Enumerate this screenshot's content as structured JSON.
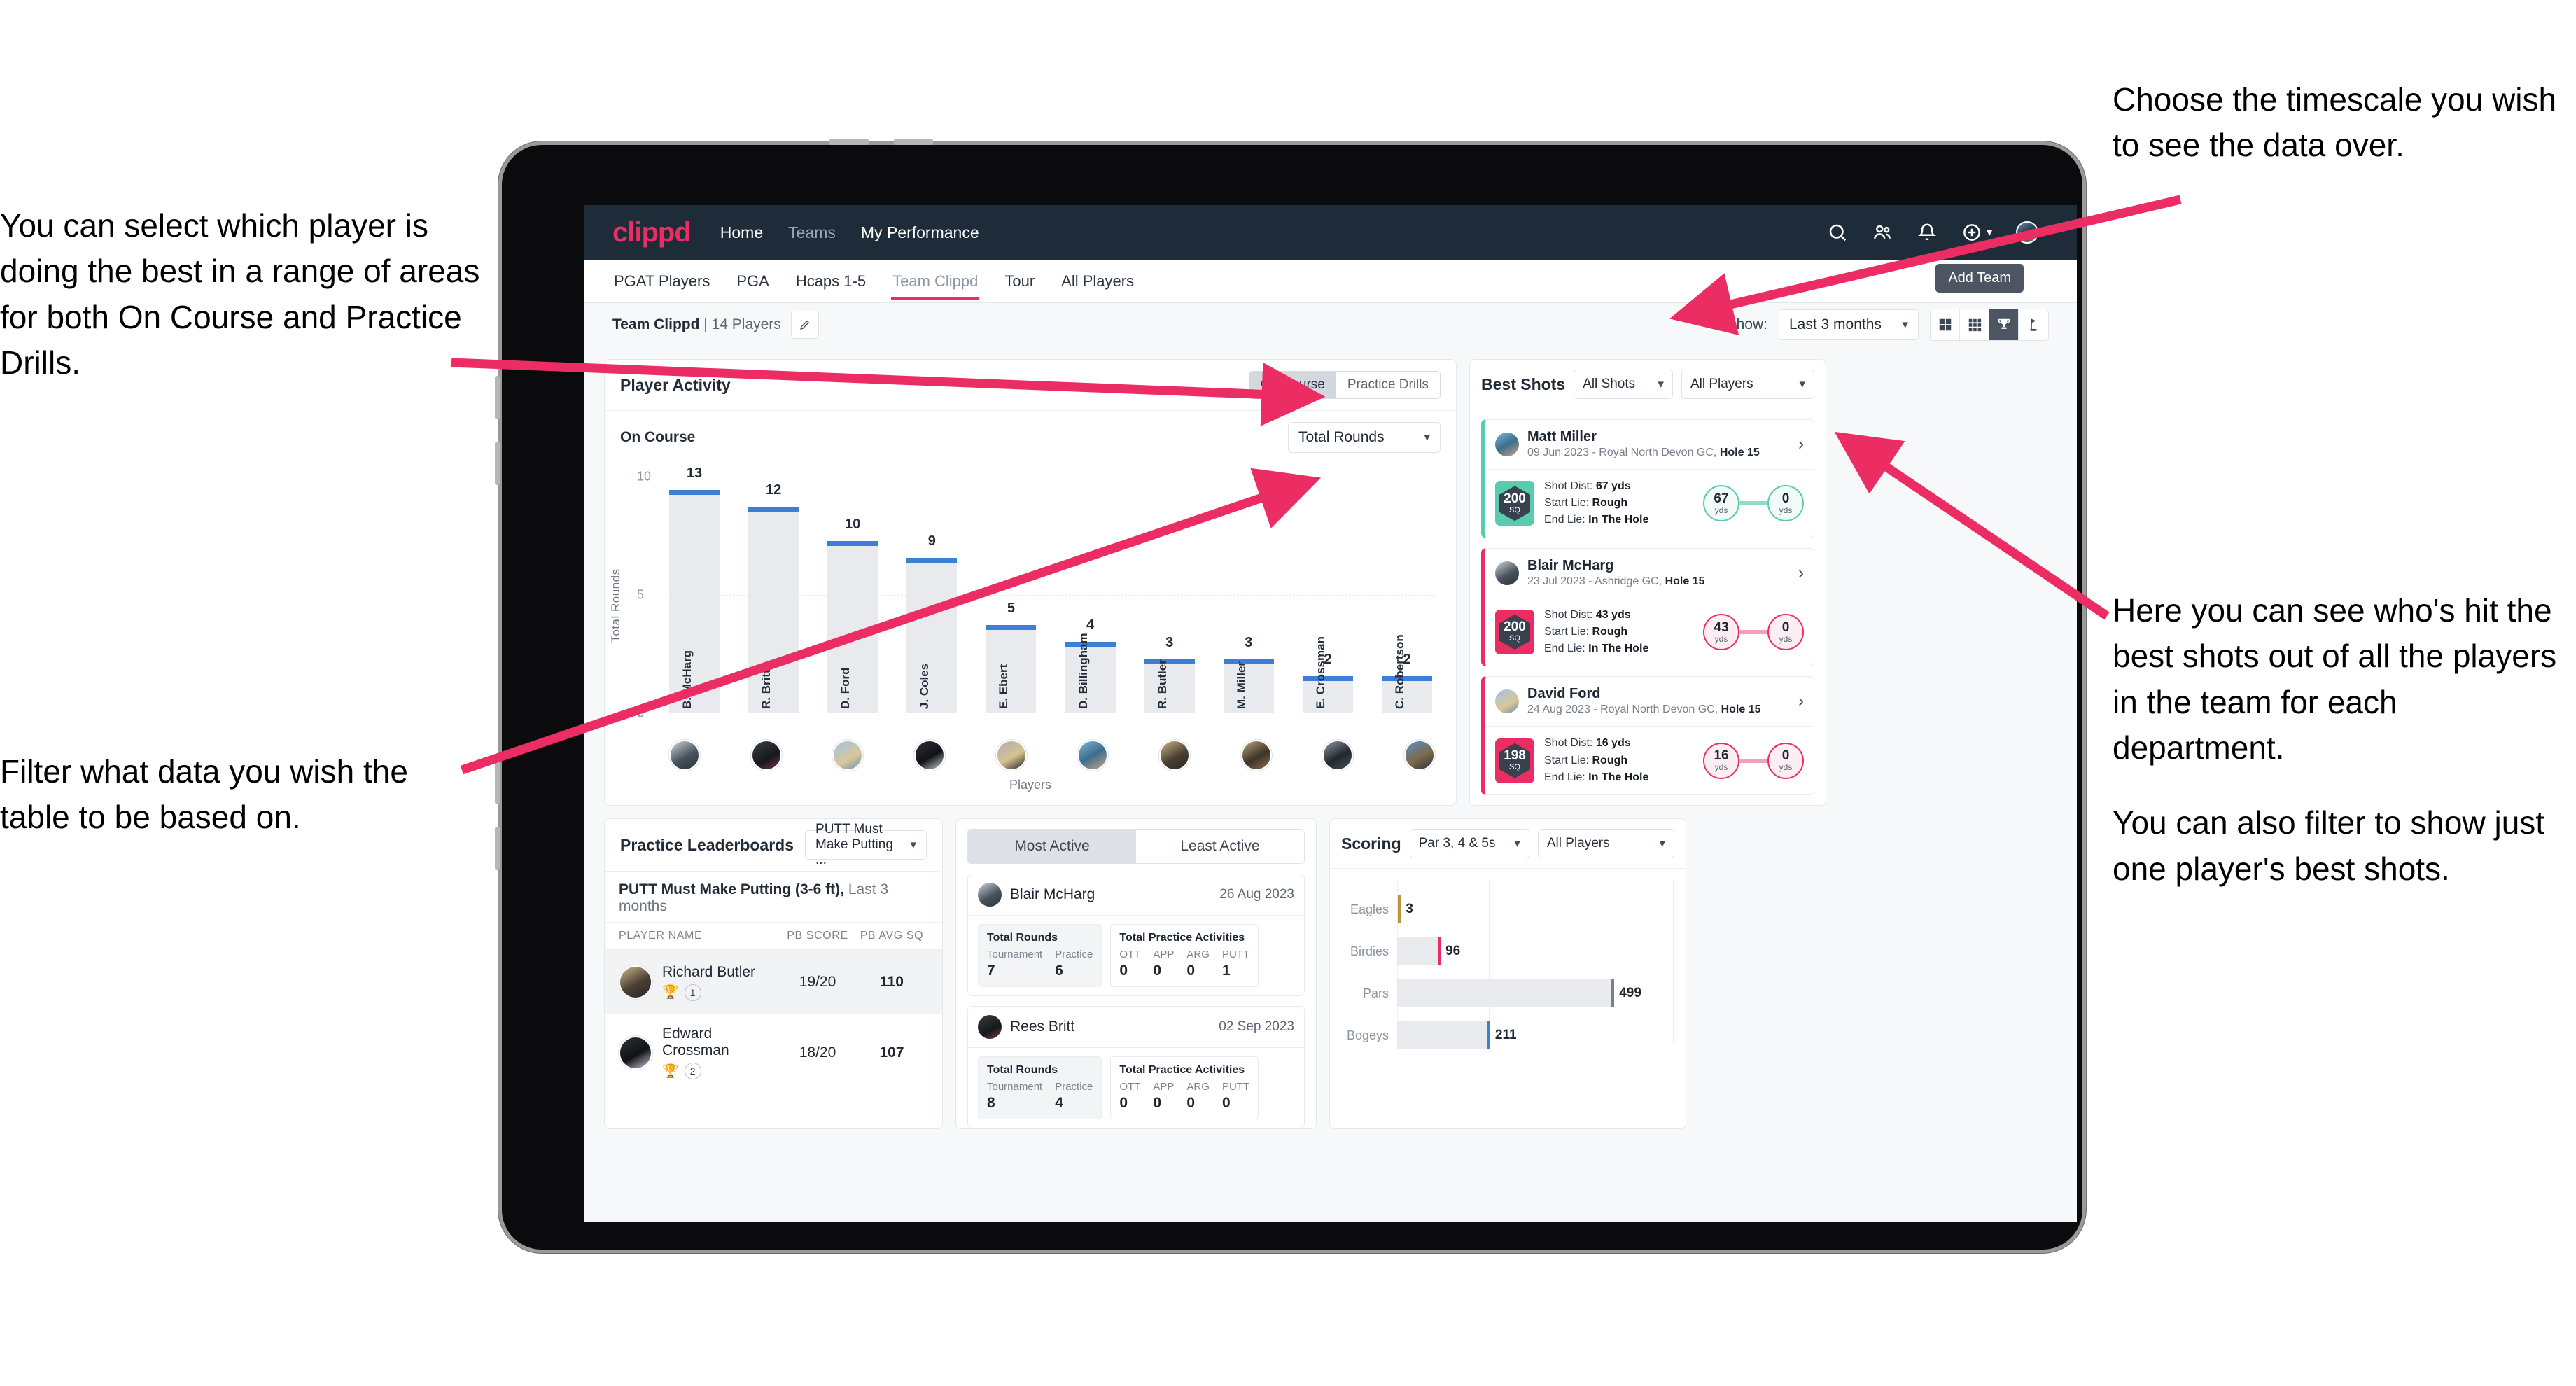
{
  "annotations": {
    "left_top": "You can select which player is doing the best in a range of areas for both On Course and Practice Drills.",
    "left_bottom": "Filter what data you wish the table to be based on.",
    "right_top": "Choose the timescale you wish to see the data over.",
    "right_mid_p1": "Here you can see who's hit the best shots out of all the players in the team for each department.",
    "right_mid_p2": "You can also filter to show just one player's best shots."
  },
  "navbar": {
    "logo": "clippd",
    "links": [
      {
        "label": "Home",
        "dim": false
      },
      {
        "label": "Teams",
        "dim": true
      },
      {
        "label": "My Performance",
        "dim": false
      }
    ],
    "icons": [
      "search-icon",
      "people-icon",
      "bell-icon",
      "plus-circle-icon",
      "avatar"
    ]
  },
  "tabs": {
    "items": [
      {
        "label": "PGAT Players",
        "active": false
      },
      {
        "label": "PGA",
        "active": false
      },
      {
        "label": "Hcaps 1-5",
        "active": false
      },
      {
        "label": "Team Clippd",
        "active": true
      },
      {
        "label": "Tour",
        "active": false
      },
      {
        "label": "All Players",
        "active": false
      }
    ],
    "tooltip": "Add Team"
  },
  "subheader": {
    "team_name": "Team Clippd",
    "team_count": "| 14 Players",
    "show_label": "Show:",
    "timescale": "Last 3 months",
    "view_toggles": [
      {
        "name": "grid-2x2-icon",
        "active": false
      },
      {
        "name": "grid-3x3-icon",
        "active": false
      },
      {
        "name": "trophy-icon",
        "active": true
      },
      {
        "name": "golf-flag-icon",
        "active": false
      }
    ]
  },
  "player_activity": {
    "title": "Player Activity",
    "segments": [
      {
        "label": "On Course",
        "active": true
      },
      {
        "label": "Practice Drills",
        "active": false
      }
    ],
    "sub_label": "On Course",
    "metric_select": "Total Rounds"
  },
  "chart_data": [
    {
      "type": "bar",
      "title": "Player Activity",
      "xlabel": "Players",
      "ylabel": "Total Rounds",
      "ylim": [
        0,
        14
      ],
      "yticks": [
        0,
        5,
        10
      ],
      "grid": true,
      "categories": [
        "B. McHarg",
        "R. Britt",
        "D. Ford",
        "J. Coles",
        "E. Ebert",
        "D. Billingham",
        "R. Butler",
        "M. Miller",
        "E. Crossman",
        "C. Robertson"
      ],
      "values": [
        13,
        12,
        10,
        9,
        5,
        4,
        3,
        3,
        2,
        2
      ]
    },
    {
      "type": "bar",
      "title": "Scoring",
      "orientation": "horizontal",
      "xlabel": "",
      "ylabel": "",
      "xlim": [
        0,
        640
      ],
      "grid": true,
      "categories": [
        "Eagles",
        "Birdies",
        "Pars",
        "Bogeys"
      ],
      "values": [
        3,
        96,
        499,
        211
      ],
      "colors": [
        "#bb9540",
        "#ec2d63",
        "#77808c",
        "#3d7fd6"
      ]
    }
  ],
  "best_shots": {
    "title": "Best Shots",
    "shot_filter": "All Shots",
    "player_filter": "All Players",
    "items": [
      {
        "name": "Matt Miller",
        "meta_date": "09 Jun 2023 - Royal North Devon GC,",
        "meta_hole": "Hole 15",
        "sq": "200",
        "sq_unit": "SQ",
        "accent": "teal",
        "shot_dist_label": "Shot Dist:",
        "shot_dist": "67 yds",
        "start_lie_label": "Start Lie:",
        "start_lie": "Rough",
        "end_lie_label": "End Lie:",
        "end_lie": "In The Hole",
        "from_val": "67",
        "from_unit": "yds",
        "to_val": "0",
        "to_unit": "yds"
      },
      {
        "name": "Blair McHarg",
        "meta_date": "23 Jul 2023 - Ashridge GC,",
        "meta_hole": "Hole 15",
        "sq": "200",
        "sq_unit": "SQ",
        "accent": "pink",
        "shot_dist_label": "Shot Dist:",
        "shot_dist": "43 yds",
        "start_lie_label": "Start Lie:",
        "start_lie": "Rough",
        "end_lie_label": "End Lie:",
        "end_lie": "In The Hole",
        "from_val": "43",
        "from_unit": "yds",
        "to_val": "0",
        "to_unit": "yds"
      },
      {
        "name": "David Ford",
        "meta_date": "24 Aug 2023 - Royal North Devon GC,",
        "meta_hole": "Hole 15",
        "sq": "198",
        "sq_unit": "SQ",
        "accent": "pink",
        "shot_dist_label": "Shot Dist:",
        "shot_dist": "16 yds",
        "start_lie_label": "Start Lie:",
        "start_lie": "Rough",
        "end_lie_label": "End Lie:",
        "end_lie": "In The Hole",
        "from_val": "16",
        "from_unit": "yds",
        "to_val": "0",
        "to_unit": "yds"
      }
    ]
  },
  "practice_leaderboards": {
    "title": "Practice Leaderboards",
    "drill_select": "PUTT Must Make Putting ...",
    "subtitle_bold": "PUTT Must Make Putting (3-6 ft),",
    "subtitle_light": "Last 3 months",
    "columns": [
      "PLAYER NAME",
      "PB SCORE",
      "PB AVG SQ"
    ],
    "rows": [
      {
        "name": "Richard Butler",
        "rank": "1",
        "trophy": "gold",
        "pb_score": "19/20",
        "pb_avg_sq": "110"
      },
      {
        "name": "Edward Crossman",
        "rank": "2",
        "trophy": "silver",
        "pb_score": "18/20",
        "pb_avg_sq": "107"
      }
    ]
  },
  "activity": {
    "tabs": [
      {
        "label": "Most Active",
        "active": true
      },
      {
        "label": "Least Active",
        "active": false
      }
    ],
    "cards": [
      {
        "name": "Blair McHarg",
        "date": "26 Aug 2023",
        "rounds_title": "Total Rounds",
        "rounds": [
          {
            "label": "Tournament",
            "value": "7"
          },
          {
            "label": "Practice",
            "value": "6"
          }
        ],
        "practice_title": "Total Practice Activities",
        "practice": [
          {
            "label": "OTT",
            "value": "0"
          },
          {
            "label": "APP",
            "value": "0"
          },
          {
            "label": "ARG",
            "value": "0"
          },
          {
            "label": "PUTT",
            "value": "1"
          }
        ]
      },
      {
        "name": "Rees Britt",
        "date": "02 Sep 2023",
        "rounds_title": "Total Rounds",
        "rounds": [
          {
            "label": "Tournament",
            "value": "8"
          },
          {
            "label": "Practice",
            "value": "4"
          }
        ],
        "practice_title": "Total Practice Activities",
        "practice": [
          {
            "label": "OTT",
            "value": "0"
          },
          {
            "label": "APP",
            "value": "0"
          },
          {
            "label": "ARG",
            "value": "0"
          },
          {
            "label": "PUTT",
            "value": "0"
          }
        ]
      }
    ]
  },
  "scoring": {
    "title": "Scoring",
    "par_filter": "Par 3, 4 & 5s",
    "player_filter": "All Players"
  },
  "colors": {
    "brand_pink": "#ec2d63",
    "navy": "#1e2b39",
    "bar_blue": "#3d7fd6",
    "teal": "#57cdad",
    "bar_grey": "#e8eaee"
  }
}
